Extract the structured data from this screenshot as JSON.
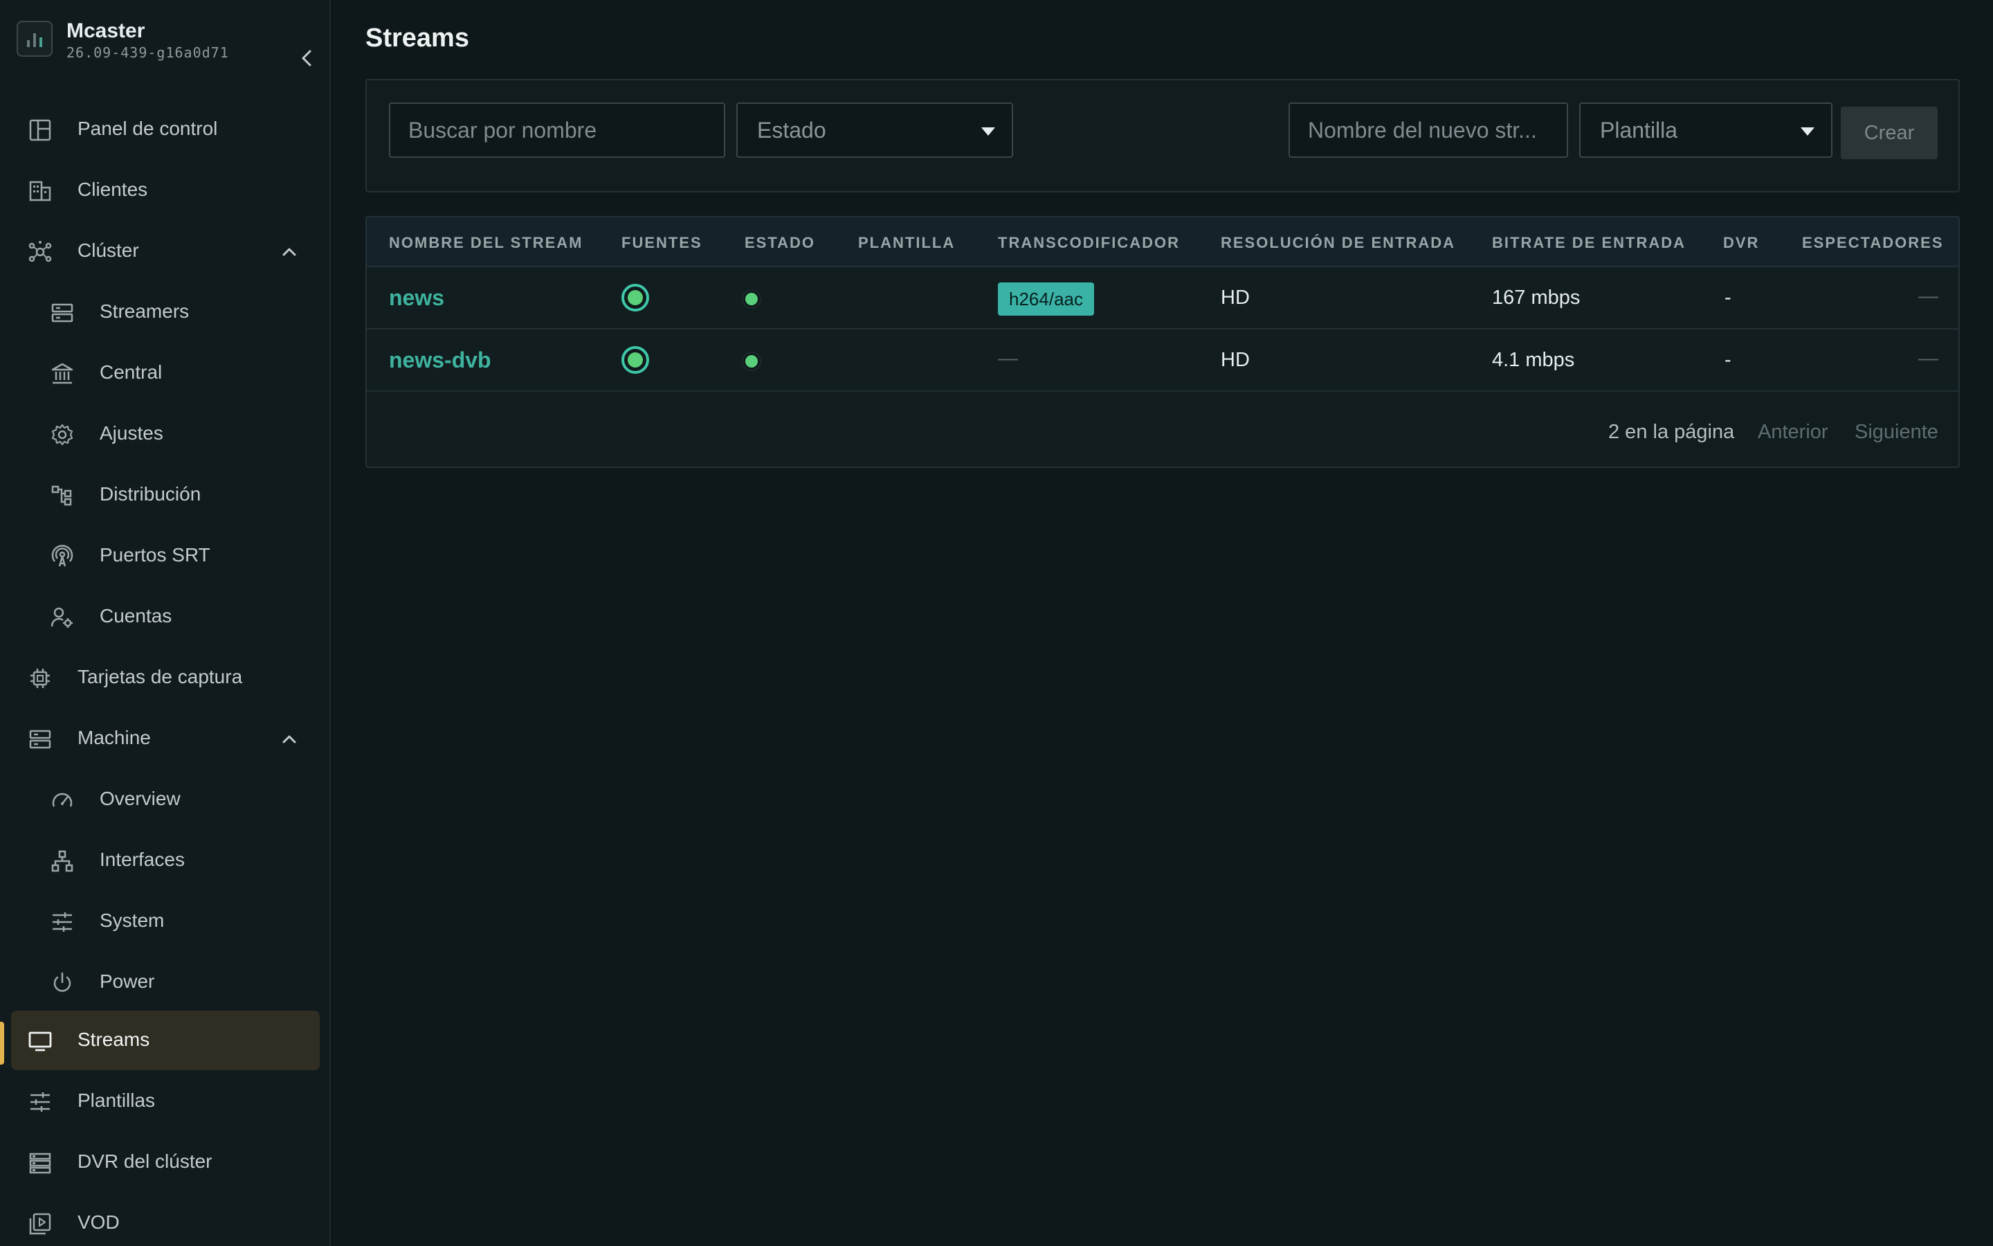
{
  "app": {
    "name": "Mcaster",
    "version": "26.09-439-g16a0d71"
  },
  "sidebar": {
    "items": [
      {
        "label": "Panel de control",
        "icon": "dashboard-icon"
      },
      {
        "label": "Clientes",
        "icon": "building-icon"
      },
      {
        "label": "Clúster",
        "icon": "cluster-icon",
        "expanded": true
      },
      {
        "label": "Streamers",
        "icon": "server-icon"
      },
      {
        "label": "Central",
        "icon": "bank-icon"
      },
      {
        "label": "Ajustes",
        "icon": "gear-icon"
      },
      {
        "label": "Distribución",
        "icon": "hierarchy-icon"
      },
      {
        "label": "Puertos SRT",
        "icon": "antenna-icon"
      },
      {
        "label": "Cuentas",
        "icon": "user-gear-icon"
      },
      {
        "label": "Tarjetas de captura",
        "icon": "chip-icon"
      },
      {
        "label": "Machine",
        "icon": "server-icon",
        "expanded": true
      },
      {
        "label": "Overview",
        "icon": "gauge-icon"
      },
      {
        "label": "Interfaces",
        "icon": "network-icon"
      },
      {
        "label": "System",
        "icon": "sliders-icon"
      },
      {
        "label": "Power",
        "icon": "power-icon"
      },
      {
        "label": "Streams",
        "icon": "monitor-icon",
        "active": true
      },
      {
        "label": "Plantillas",
        "icon": "sliders-icon"
      },
      {
        "label": "DVR del clúster",
        "icon": "storage-icon"
      },
      {
        "label": "VOD",
        "icon": "video-library-icon"
      }
    ]
  },
  "page": {
    "title": "Streams"
  },
  "toolbar": {
    "search_placeholder": "Buscar por nombre",
    "status_select": "Estado",
    "new_stream_placeholder": "Nombre del nuevo str...",
    "template_select": "Plantilla",
    "create_label": "Crear"
  },
  "table": {
    "columns": [
      "NOMBRE DEL STREAM",
      "FUENTES",
      "ESTADO",
      "PLANTILLA",
      "TRANSCODIFICADOR",
      "RESOLUCIÓN DE ENTRADA",
      "BITRATE DE ENTRADA",
      "DVR",
      "ESPECTADORES"
    ],
    "rows": [
      {
        "name": "news",
        "sources": "online",
        "status": "running",
        "template": "",
        "transcoder": "h264/aac",
        "resolution": "HD",
        "bitrate": "167 mbps",
        "dvr": "-",
        "viewers": "—"
      },
      {
        "name": "news-dvb",
        "sources": "online",
        "status": "running",
        "template": "",
        "transcoder": "—",
        "resolution": "HD",
        "bitrate": "4.1 mbps",
        "dvr": "-",
        "viewers": "—"
      }
    ]
  },
  "pagination": {
    "count_label": "2 en la página",
    "prev_label": "Anterior",
    "next_label": "Siguiente"
  },
  "colors": {
    "accent": "#3eb39f",
    "active_bar": "#e0b34c",
    "status_green": "#5bd07a",
    "badge": "#3ab3a6"
  }
}
